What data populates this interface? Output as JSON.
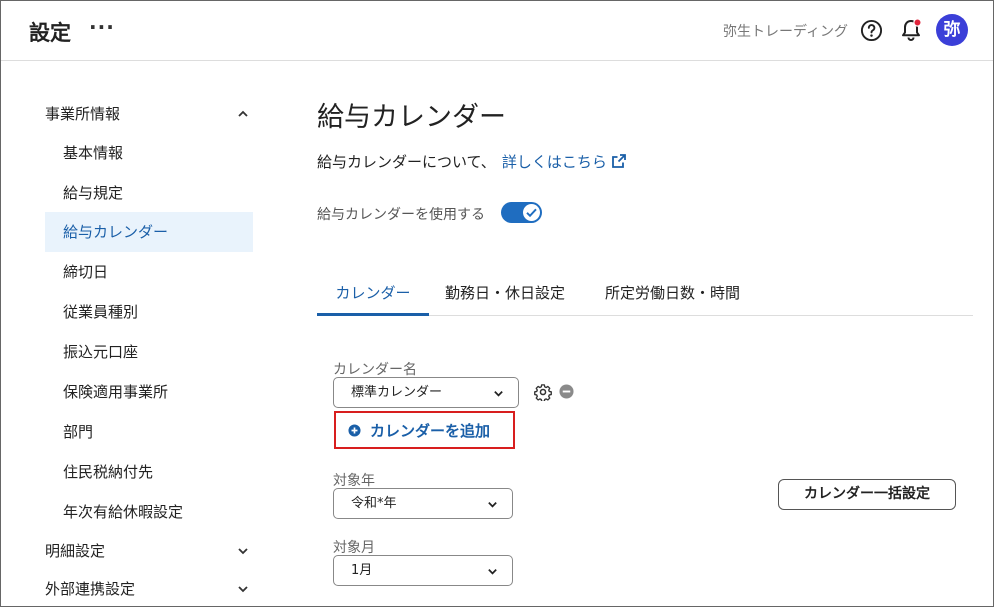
{
  "header": {
    "title": "設定",
    "more": "···",
    "company": "弥生トレーディング",
    "avatar_initial": "弥"
  },
  "sidebar": {
    "items": [
      {
        "label": "事業所情報",
        "expanded": true
      },
      {
        "label": "基本情報"
      },
      {
        "label": "給与規定"
      },
      {
        "label": "給与カレンダー",
        "active": true
      },
      {
        "label": "締切日"
      },
      {
        "label": "従業員種別"
      },
      {
        "label": "振込元口座"
      },
      {
        "label": "保険適用事業所"
      },
      {
        "label": "部門"
      },
      {
        "label": "住民税納付先"
      },
      {
        "label": "年次有給休暇設定"
      },
      {
        "label": "明細設定",
        "expanded": false
      },
      {
        "label": "外部連携設定",
        "expanded": false
      }
    ]
  },
  "main": {
    "title": "給与カレンダー",
    "intro_text": "給与カレンダーについて、",
    "intro_link": "詳しくはこちら",
    "toggle_label": "給与カレンダーを使用する",
    "toggle_on": true,
    "tabs": [
      {
        "label": "カレンダー",
        "active": true
      },
      {
        "label": "勤務日・休日設定"
      },
      {
        "label": "所定労働日数・時間"
      }
    ],
    "calendar_name_label": "カレンダー名",
    "calendar_name_value": "標準カレンダー",
    "add_calendar_label": "カレンダーを追加",
    "year_label": "対象年",
    "year_value": "令和*年",
    "month_label": "対象月",
    "month_value": "1月",
    "bulk_button_label": "カレンダー一括設定"
  },
  "colors": {
    "accent": "#1a5fa8",
    "avatar": "#3b3fd8",
    "highlight_border": "#d81e1e",
    "active_bg": "#e9f3fc"
  }
}
